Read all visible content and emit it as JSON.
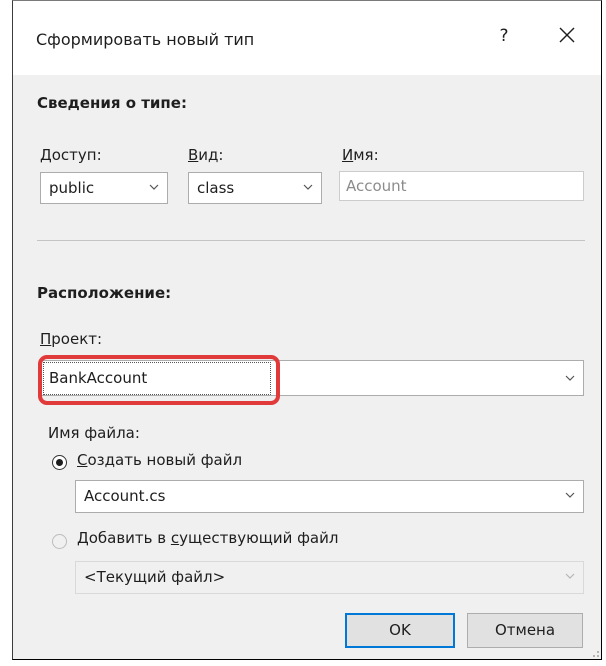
{
  "window": {
    "title": "Сформировать новый тип",
    "help_label": "?"
  },
  "type_info": {
    "heading": "Сведения о типе:",
    "access": {
      "label_hotkey": "Д",
      "label_rest": "оступ:",
      "value": "public"
    },
    "kind": {
      "label_hotkey": "В",
      "label_rest": "ид:",
      "value": "class"
    },
    "name": {
      "label_hotkey": "И",
      "label_rest": "мя:",
      "value": "Account"
    }
  },
  "location": {
    "heading": "Расположение:",
    "project": {
      "label_hotkey": "П",
      "label_rest": "роект:",
      "value": "BankAccount"
    },
    "file_name_label": "Имя файла:",
    "create_new": {
      "label_hotkey": "С",
      "label_rest": "оздать новый файл",
      "checked": true,
      "value": "Account.cs"
    },
    "add_existing": {
      "label_before": "Добавить в ",
      "label_hotkey": "с",
      "label_rest": "уществующий файл",
      "checked": false,
      "value": "<Текущий файл>"
    }
  },
  "buttons": {
    "ok": "OK",
    "cancel": "Отмена"
  },
  "colors": {
    "highlight": "#e03a3a",
    "default_button_border": "#0078d7",
    "client_bg": "#f0f0f0"
  }
}
